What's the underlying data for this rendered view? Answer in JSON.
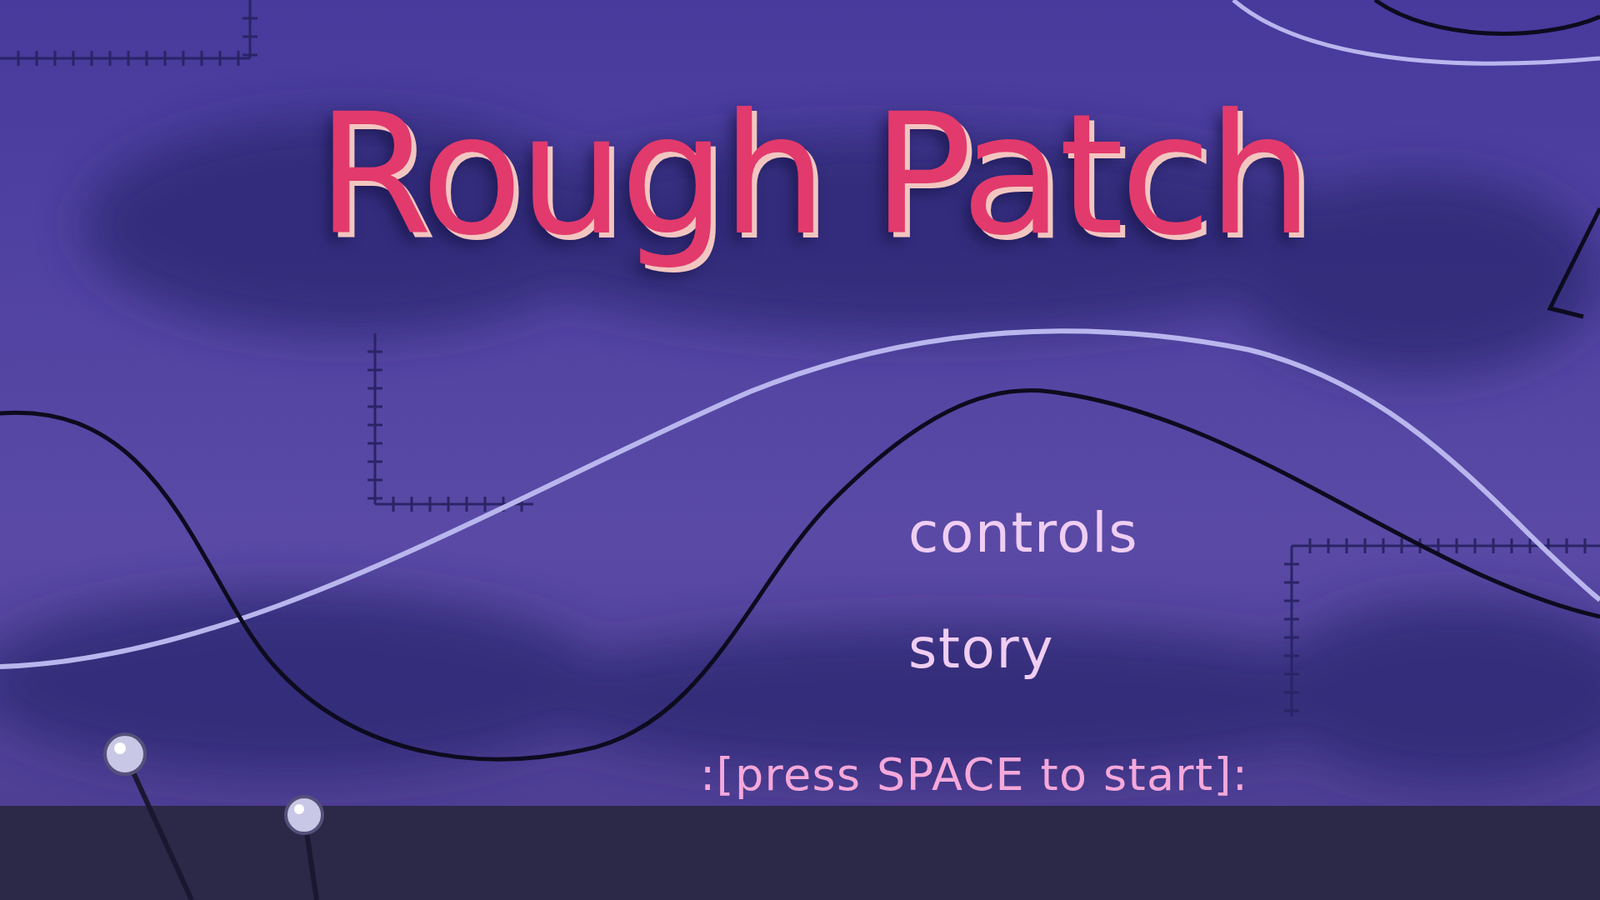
{
  "title": "Rough Patch",
  "menu": [
    {
      "label": "controls"
    },
    {
      "label": "story"
    }
  ],
  "prompt": ":[press SPACE to start]:"
}
